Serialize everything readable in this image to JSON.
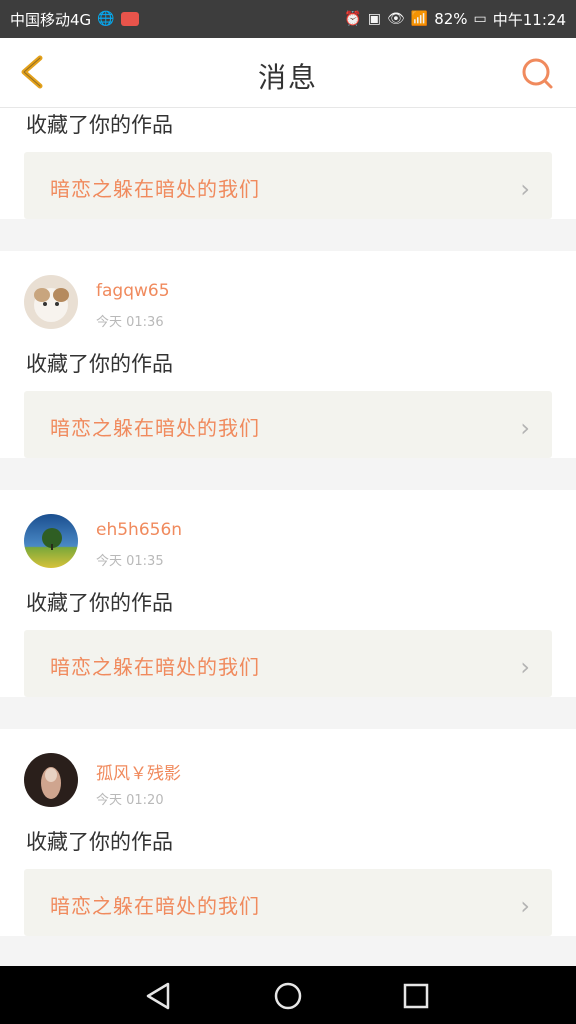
{
  "status_bar": {
    "carrier": "中国移动4G",
    "battery": "82%",
    "time": "中午11:24",
    "signal_label": "4G"
  },
  "header": {
    "title": "消息"
  },
  "items": [
    {
      "action": "收藏了你的作品",
      "work_title": "暗恋之躲在暗处的我们"
    },
    {
      "username": "fagqw65",
      "time": "今天 01:36",
      "action": "收藏了你的作品",
      "work_title": "暗恋之躲在暗处的我们"
    },
    {
      "username": "eh5h656n",
      "time": "今天 01:35",
      "action": "收藏了你的作品",
      "work_title": "暗恋之躲在暗处的我们"
    },
    {
      "username": "孤风￥残影",
      "time": "今天 01:20",
      "action": "收藏了你的作品",
      "work_title": "暗恋之躲在暗处的我们"
    }
  ],
  "colors": {
    "accent": "#f08a5d",
    "status_bar": "#3d3d3d",
    "back_icon": "#e3a11b",
    "card_bg": "#f3f3ee"
  },
  "icons": {
    "back": "chevron-left-icon",
    "search": "search-icon",
    "nav_back": "triangle-back-icon",
    "nav_home": "circle-home-icon",
    "nav_recent": "square-recent-icon"
  }
}
